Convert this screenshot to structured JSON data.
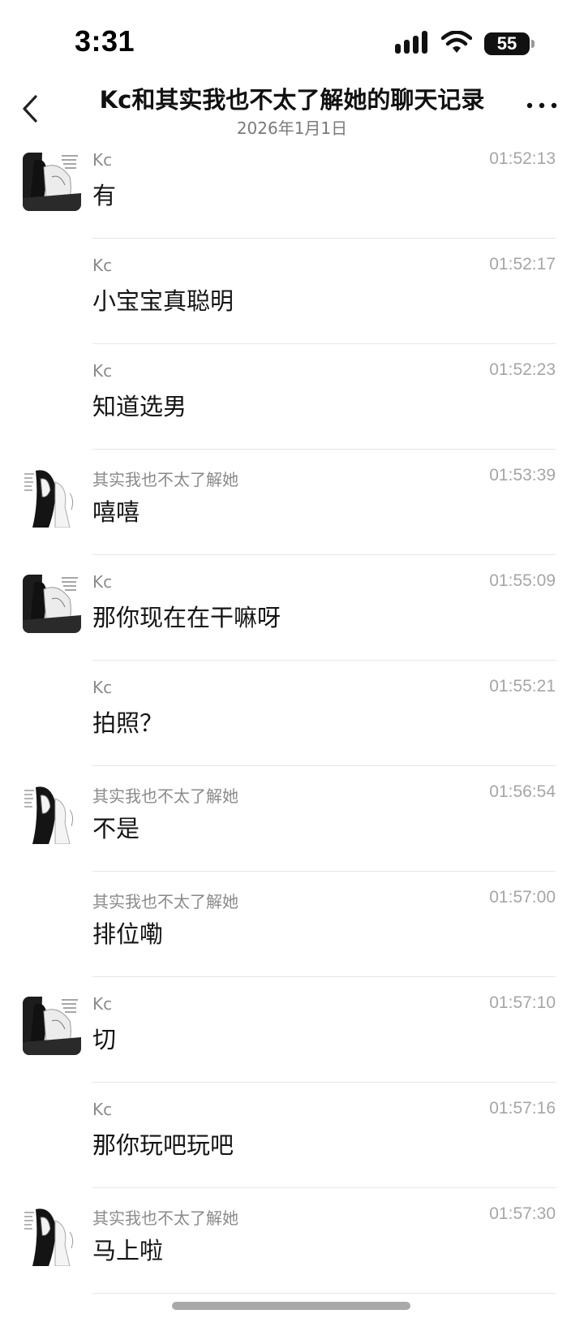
{
  "status_bar": {
    "time": "3:31",
    "battery": "55",
    "signal_icon": "cellular-signal-icon",
    "wifi_icon": "wifi-icon"
  },
  "nav": {
    "title": "Kc和其实我也不太了解她的聊天记录",
    "date": "2026年1月1日",
    "back_icon": "chevron-left-icon",
    "more_icon": "more-horizontal-icon"
  },
  "messages": [
    {
      "sender": "Kc",
      "time": "01:52:13",
      "text": "有",
      "avatar": "kc"
    },
    {
      "sender": "Kc",
      "time": "01:52:17",
      "text": "小宝宝真聪明",
      "avatar": ""
    },
    {
      "sender": "Kc",
      "time": "01:52:23",
      "text": "知道选男",
      "avatar": ""
    },
    {
      "sender": "其实我也不太了解她",
      "time": "01:53:39",
      "text": "嘻嘻",
      "avatar": "girl"
    },
    {
      "sender": "Kc",
      "time": "01:55:09",
      "text": "那你现在在干嘛呀",
      "avatar": "kc"
    },
    {
      "sender": "Kc",
      "time": "01:55:21",
      "text": "拍照？",
      "avatar": ""
    },
    {
      "sender": "其实我也不太了解她",
      "time": "01:56:54",
      "text": "不是",
      "avatar": "girl"
    },
    {
      "sender": "其实我也不太了解她",
      "time": "01:57:00",
      "text": "排位嘞",
      "avatar": ""
    },
    {
      "sender": "Kc",
      "time": "01:57:10",
      "text": "切",
      "avatar": "kc"
    },
    {
      "sender": "Kc",
      "time": "01:57:16",
      "text": "那你玩吧玩吧",
      "avatar": ""
    },
    {
      "sender": "其实我也不太了解她",
      "time": "01:57:30",
      "text": "马上啦",
      "avatar": "girl"
    }
  ],
  "colors": {
    "background": "#ffffff",
    "text": "#141414",
    "sender": "#8a8a8a",
    "timestamp": "#a6a6a6",
    "divider": "#e6e6e6"
  }
}
